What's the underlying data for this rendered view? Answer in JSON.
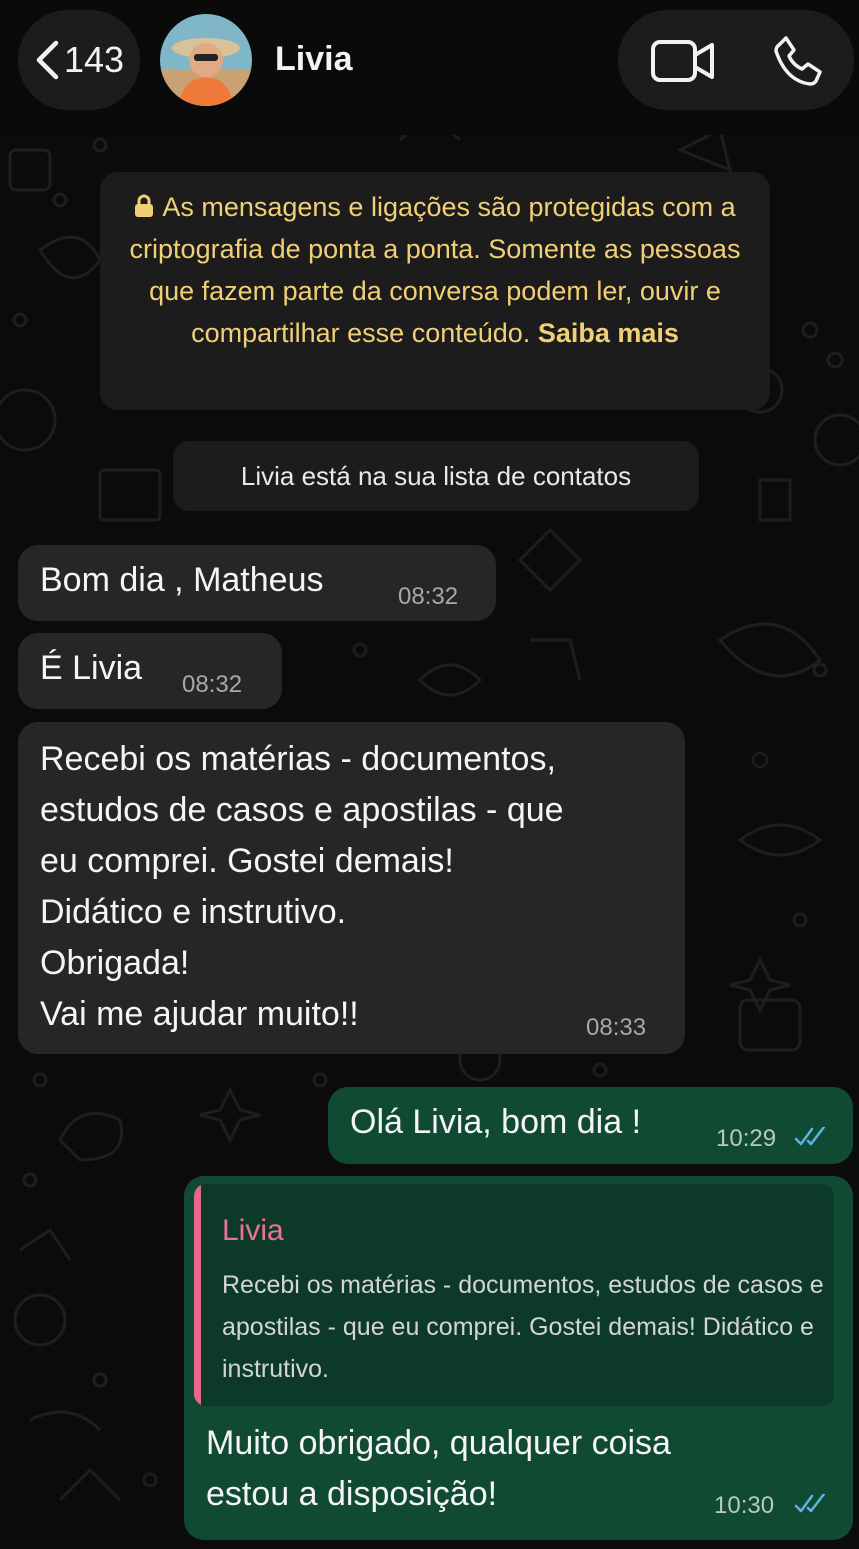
{
  "header": {
    "back_count": "143",
    "contact_name": "Livia"
  },
  "encryption_notice": {
    "text": "As mensagens e ligações são protegidas com a criptografia de ponta a ponta. Somente as pessoas que fazem parte da conversa podem ler, ouvir e compartilhar esse conteúdo.",
    "link": "Saiba mais"
  },
  "contact_notice": "Livia está na sua lista de contatos",
  "messages": [
    {
      "direction": "in",
      "text": "Bom dia , Matheus",
      "time": "08:32"
    },
    {
      "direction": "in",
      "text": "É Livia",
      "time": "08:32"
    },
    {
      "direction": "in",
      "text": "Recebi os matérias - documentos,\nestudos de casos e apostilas - que\neu comprei. Gostei demais!\nDidático e instrutivo.\nObrigada!\nVai me ajudar muito!!",
      "time": "08:33"
    },
    {
      "direction": "out",
      "text": "Olá Livia, bom dia !",
      "time": "10:29",
      "status": "read"
    },
    {
      "direction": "out",
      "quote": {
        "author": "Livia",
        "text": "Recebi os matérias - documentos, estudos de casos e apostilas - que eu comprei. Gostei demais! Didático e instrutivo."
      },
      "text": "Muito obrigado, qualquer coisa\nestou a disposição!",
      "time": "10:30",
      "status": "read"
    }
  ],
  "colors": {
    "background": "#0b0b0b",
    "incoming_bubble": "#262626",
    "outgoing_bubble": "#104a33",
    "notice_text": "#f1cf75",
    "quote_accent": "#e8668a",
    "read_ticks": "#5fb2e6"
  },
  "icons": [
    "back-chevron-icon",
    "video-call-icon",
    "phone-call-icon",
    "lock-icon",
    "read-ticks-icon"
  ]
}
